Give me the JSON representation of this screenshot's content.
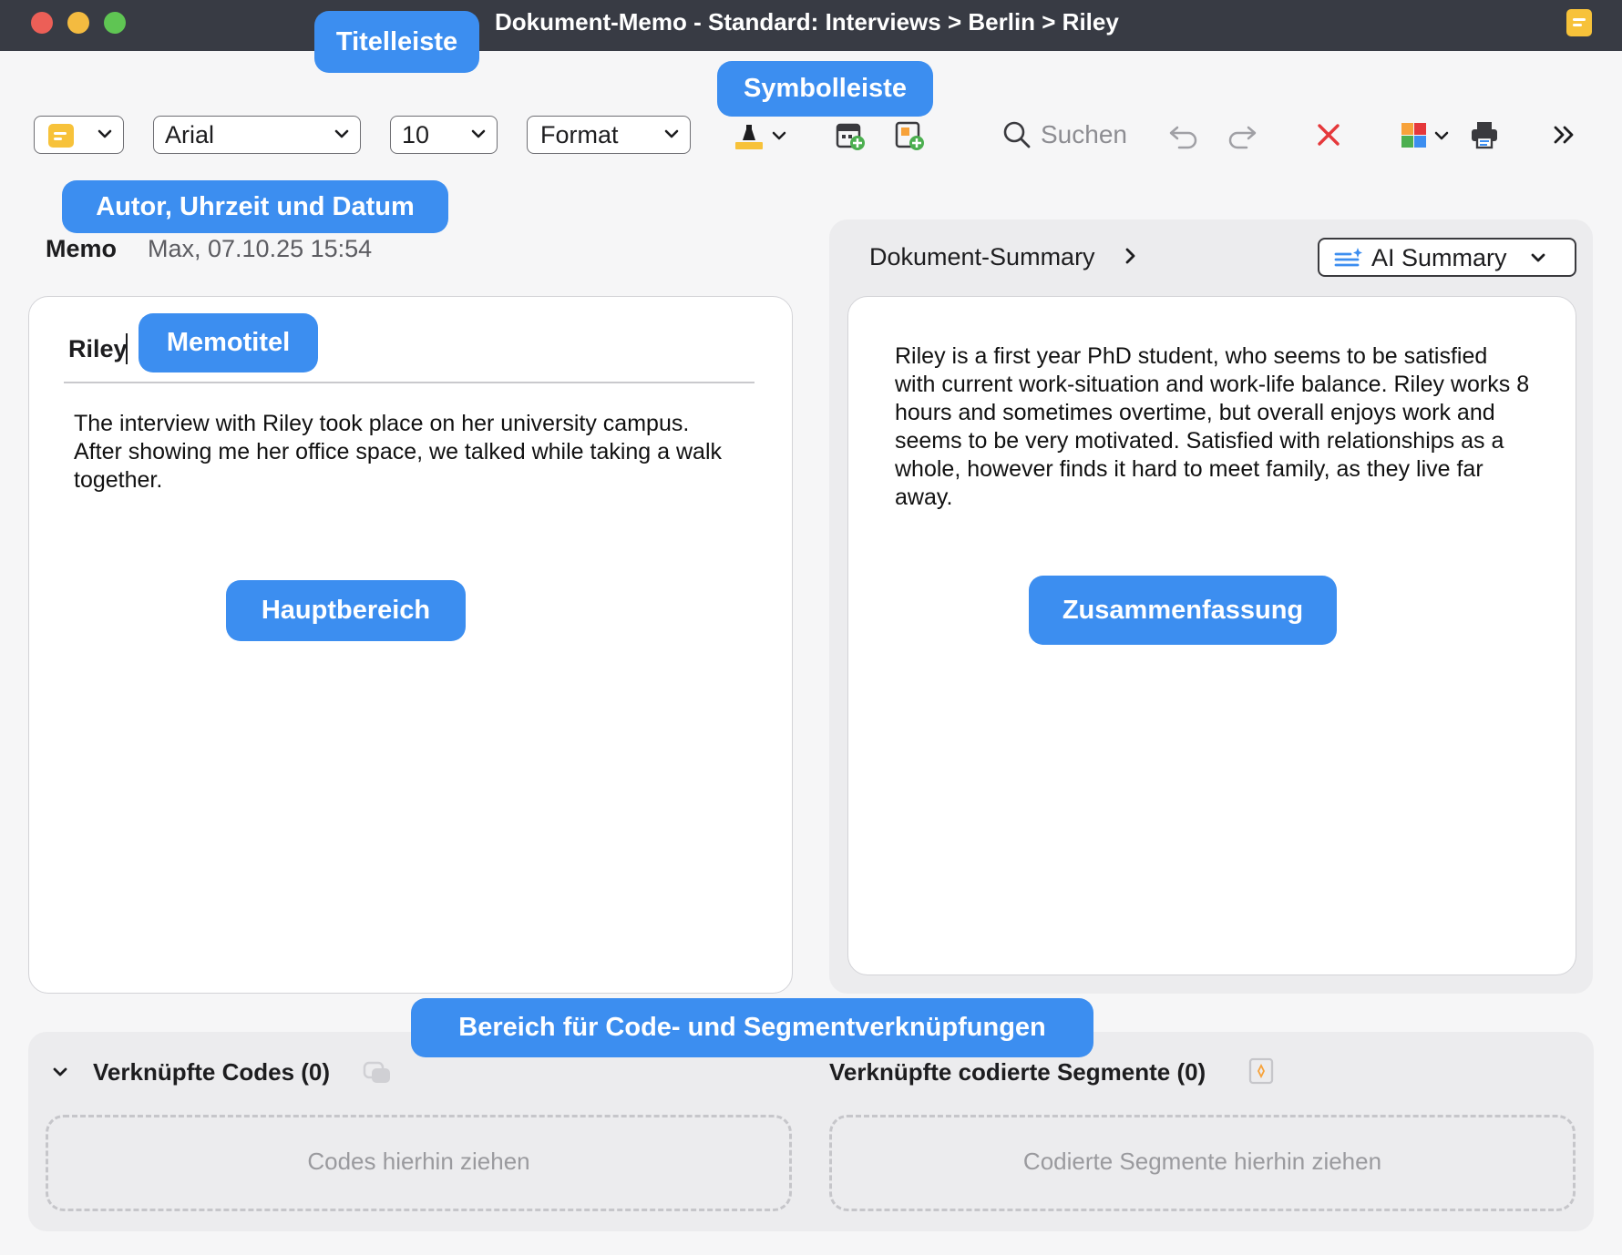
{
  "titlebar": {
    "title": "Dokument-Memo - Standard: Interviews > Berlin > Riley",
    "memo_icon": "sticky-note-icon",
    "traffic_lights": {
      "close": "#ec5f57",
      "minimize": "#f4bb40",
      "zoom": "#5fc553"
    }
  },
  "toolbar": {
    "memo_type_icon": "sticky-note-icon",
    "font_value": "Arial",
    "size_value": "10",
    "format_value": "Format",
    "search_placeholder": "Suchen",
    "icons": [
      "highlighter-icon",
      "calendar-add-icon",
      "document-add-icon",
      "search-icon",
      "undo-icon",
      "redo-icon",
      "delete-icon",
      "puzzle-icon",
      "print-icon",
      "more-icon"
    ]
  },
  "meta": {
    "label": "Memo",
    "author_date": "Max, 07.10.25 15:54"
  },
  "memo": {
    "title": "Riley",
    "body": "The interview with Riley took place on her university campus. After showing me her office space, we talked while taking a walk together."
  },
  "summary": {
    "tab_label": "Dokument-Summary",
    "ai_button_label": "AI Summary",
    "text": "Riley is a first year PhD student, who seems to be satisfied with current work-situation and work-life balance. Riley works 8 hours and sometimes overtime, but overall enjoys work and seems to be very motivated. Satisfied with relationships as a whole, however finds it hard to meet family, as they live far away."
  },
  "links": {
    "codes_heading": "Verknüpfte Codes (0)",
    "codes_drop": "Codes hierhin ziehen",
    "segments_heading": "Verknüpfte codierte Segmente (0)",
    "segments_drop": "Codierte Segmente hierhin ziehen"
  },
  "callouts": {
    "titelleiste": "Titelleiste",
    "symbolleiste": "Symbolleiste",
    "autor": "Autor, Uhrzeit und Datum",
    "memotitel": "Memotitel",
    "hauptbereich": "Hauptbereich",
    "zusammenfassung": "Zusammenfassung",
    "bereich": "Bereich für Code- und Segmentverknüpfungen"
  },
  "colors": {
    "callout": "#3c8ef0",
    "titlebar": "#383b44",
    "accent_yellow": "#f7c23a",
    "delete_red": "#e5383b"
  }
}
